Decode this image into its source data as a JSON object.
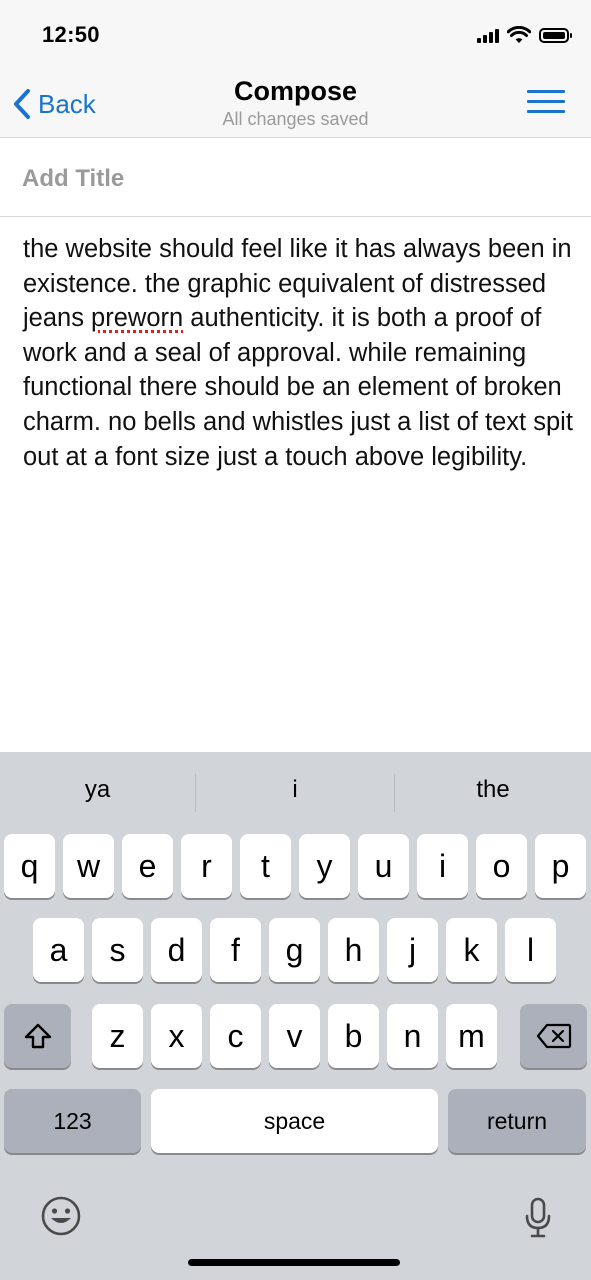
{
  "status_bar": {
    "time": "12:50",
    "signal_icon": "cellular-signal-icon",
    "wifi_icon": "wifi-icon",
    "battery_icon": "battery-icon"
  },
  "nav": {
    "back_label": "Back",
    "title": "Compose",
    "subtitle": "All changes saved",
    "menu_icon": "hamburger-menu-icon",
    "accent_color": "#1a73d1"
  },
  "editor": {
    "title_placeholder": "Add Title",
    "title_value": "",
    "body_before": "the website should feel like it has always been in existence. the graphic equivalent of distressed jeans ",
    "body_misspelled": "preworn",
    "body_after": " authenticity. it is both a proof of work and a seal of approval. while remaining functional there should be an element of broken charm. no bells and whistles just a list of text spit out at a font size just a touch above legibility."
  },
  "keyboard": {
    "predictions": [
      "ya",
      "i",
      "the"
    ],
    "row1": [
      "q",
      "w",
      "e",
      "r",
      "t",
      "y",
      "u",
      "i",
      "o",
      "p"
    ],
    "row2": [
      "a",
      "s",
      "d",
      "f",
      "g",
      "h",
      "j",
      "k",
      "l"
    ],
    "row3": [
      "z",
      "x",
      "c",
      "v",
      "b",
      "n",
      "m"
    ],
    "shift_icon": "shift-icon",
    "delete_icon": "backspace-icon",
    "numbers_label": "123",
    "space_label": "space",
    "return_label": "return",
    "emoji_icon": "emoji-icon",
    "mic_icon": "microphone-icon"
  }
}
